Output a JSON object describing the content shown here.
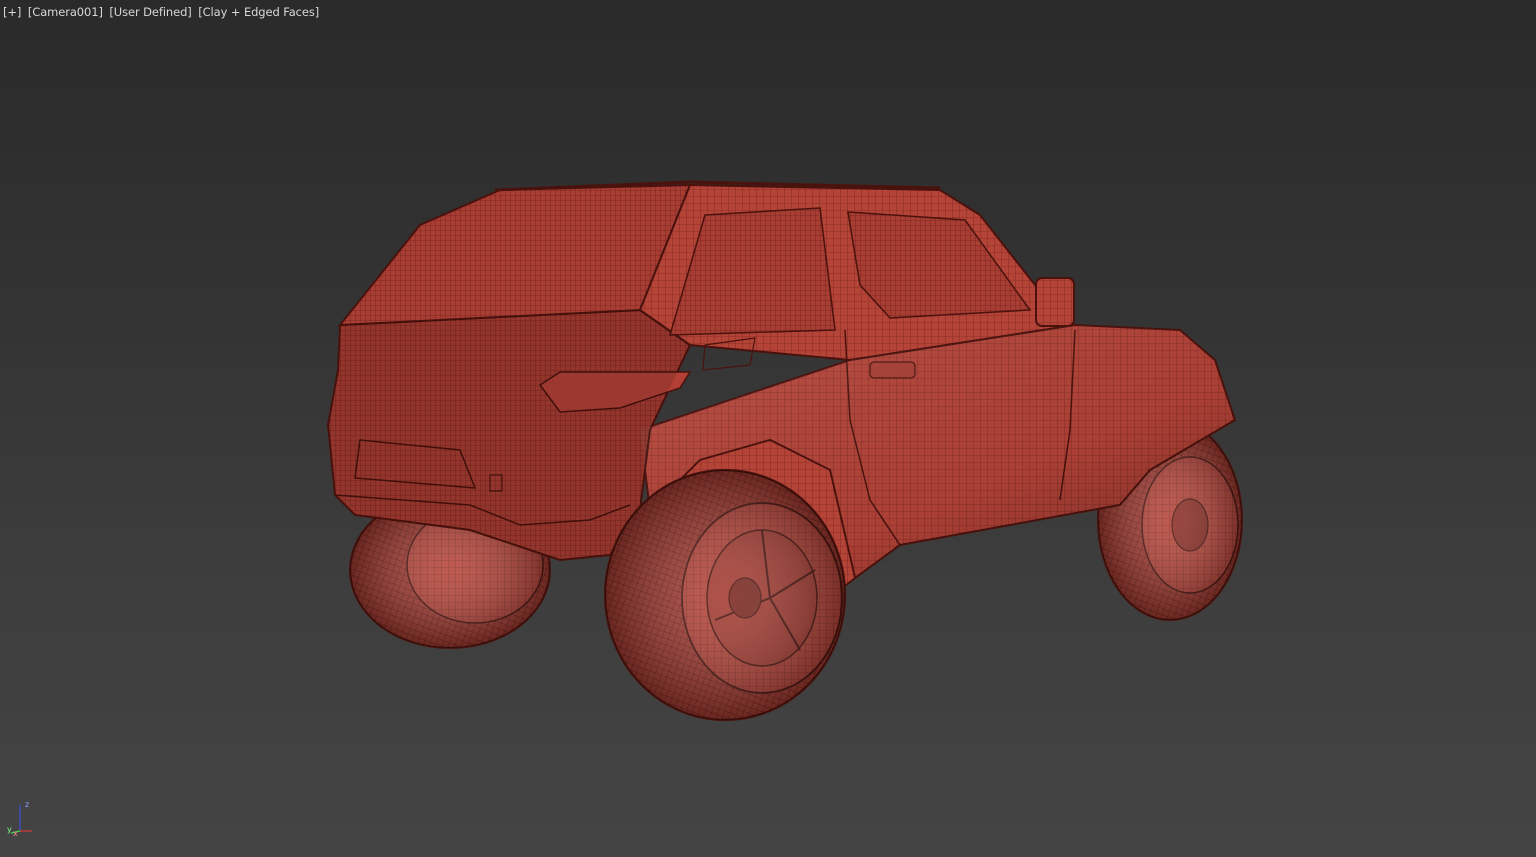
{
  "viewport": {
    "menu_plus": "[+]",
    "camera": "[Camera001]",
    "view_mode": "[User Defined]",
    "shading": "[Clay + Edged Faces]"
  },
  "model": {
    "icon": "suv-wireframe-model",
    "color": "#b8453a",
    "edge_color": "#5a1a14"
  },
  "axis": {
    "z_label": "z",
    "y_label": "y",
    "x_label": "x"
  }
}
